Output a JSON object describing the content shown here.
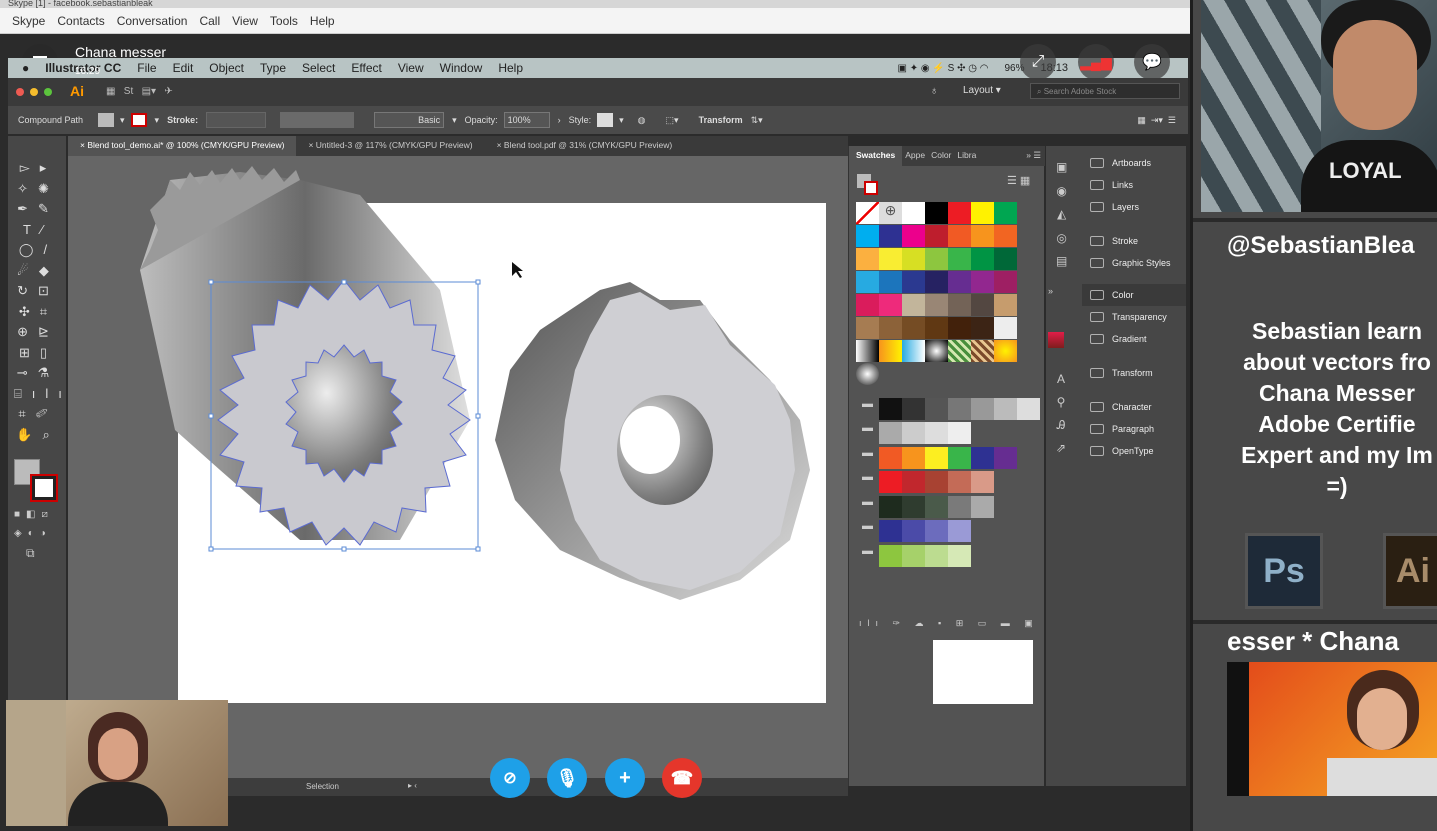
{
  "skype": {
    "title_bar": "Skype   [1] - facebook.sebastianbleak",
    "menu": [
      "Skype",
      "Contacts",
      "Conversation",
      "Call",
      "View",
      "Tools",
      "Help"
    ],
    "contact_name": "Chana messer",
    "call_time": "16:29"
  },
  "mac_menubar": {
    "app": "Illustrator CC",
    "items": [
      "File",
      "Edit",
      "Object",
      "Type",
      "Select",
      "Effect",
      "View",
      "Window",
      "Help"
    ],
    "battery": "96%",
    "clock": "18:13"
  },
  "illustrator": {
    "workspace": "Layout",
    "search_placeholder": "Search Adobe Stock",
    "control_bar": {
      "selection_type": "Compound Path",
      "stroke_label": "Stroke:",
      "brush": "Basic",
      "opacity_label": "Opacity:",
      "opacity_value": "100%",
      "style_label": "Style:",
      "transform": "Transform"
    },
    "tabs": [
      "Blend tool_demo.ai* @ 100% (CMYK/GPU Preview)",
      "Untitled-3 @ 117% (CMYK/GPU Preview)",
      "Blend tool.pdf @ 31% (CMYK/GPU Preview)"
    ],
    "status": "Selection",
    "swatch_panel_tabs": [
      "Swatches",
      "Appe",
      "Color",
      "Libra"
    ],
    "right_panel_items": [
      "Artboards",
      "Links",
      "Layers",
      "Stroke",
      "Graphic Styles",
      "Color",
      "Transparency",
      "Gradient",
      "Transform",
      "Character",
      "Paragraph",
      "OpenType"
    ],
    "selected_panel": "Color"
  },
  "promo": {
    "handle": "@SebastianBlea",
    "desc_lines": [
      "Sebastian learn",
      "about vectors fro",
      "Chana Messer",
      "Adobe Certifie",
      "Expert and my Im",
      "=)"
    ],
    "app_icons": [
      "Ps",
      "Ai"
    ],
    "ticker": "esser *  Chana"
  },
  "colors": {
    "skype_blue": "#1ea0e8",
    "hangup_red": "#e5362b"
  },
  "call_controls": [
    "video-off",
    "mic",
    "add",
    "hang-up"
  ]
}
